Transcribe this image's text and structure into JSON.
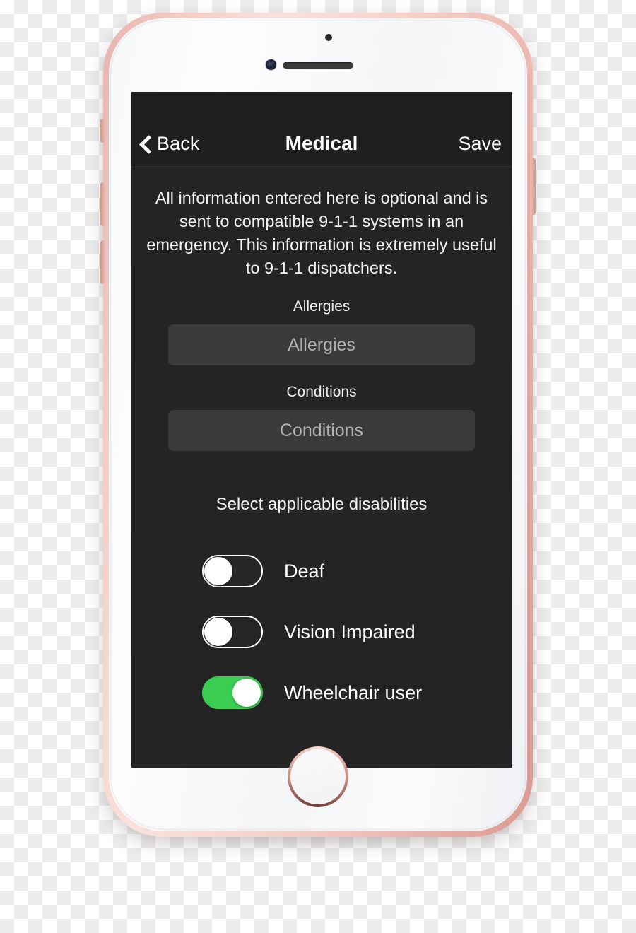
{
  "device": {
    "frame_color": "#eebdb5",
    "face_color": "#f7f8fa",
    "hardware": {
      "earpiece": "earpiece-speaker",
      "camera": "front-camera",
      "sensor": "proximity-sensor",
      "home": "home-button",
      "mute_switch": "mute-switch",
      "volume_up": "volume-up-button",
      "volume_down": "volume-down-button",
      "power": "power-button"
    }
  },
  "screen": {
    "background": "#242424",
    "navbar": {
      "background": "#1f1f1f",
      "back_label": "Back",
      "title": "Medical",
      "save_label": "Save"
    },
    "intro_text": "All information entered here is optional and is sent to compatible 9-1-1 systems in an emergency. This information is extremely useful to 9-1-1 dispatchers.",
    "fields": [
      {
        "label": "Allergies",
        "placeholder": "Allergies",
        "value": ""
      },
      {
        "label": "Conditions",
        "placeholder": "Conditions",
        "value": ""
      }
    ],
    "disabilities": {
      "section_title": "Select applicable disabilities",
      "on_color": "#3ACD52",
      "items": [
        {
          "label": "Deaf",
          "on": false
        },
        {
          "label": "Vision Impaired",
          "on": false
        },
        {
          "label": "Wheelchair user",
          "on": true
        }
      ]
    }
  }
}
